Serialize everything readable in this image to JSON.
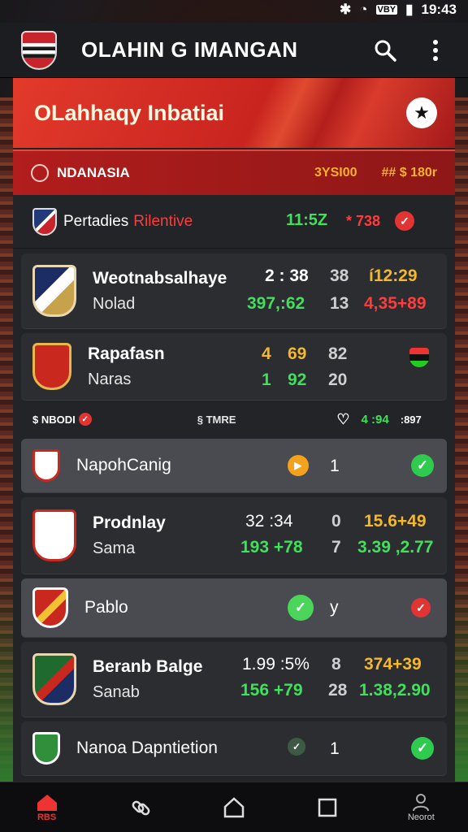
{
  "status": {
    "signal_badge": "VBY",
    "time": "19:43"
  },
  "appbar": {
    "title": "OLAHIN G IMANGAN"
  },
  "hero": {
    "title": "OLahhaqy Inbatiai"
  },
  "league": {
    "name": "NDANASIA",
    "code": "3YSI00",
    "odds": "## $ 180r"
  },
  "section": {
    "name": "Pertadies",
    "highlight": "Rilentive",
    "time": "11:5Z",
    "value": "* 738"
  },
  "matches": [
    {
      "name1": "Weotnabsalhaye",
      "name2": "Nolad",
      "a1": "2 : 38",
      "a2": "397,:62",
      "b1": "38",
      "b2": "13",
      "c1": "í12:29",
      "c2": "4,35+89"
    },
    {
      "name1": "Rapafasn",
      "name2": "Naras",
      "a1": "4",
      "a1b": "69",
      "a2": "1",
      "a2b": "92",
      "b1": "82",
      "b2": "20"
    },
    {
      "name1": "Prodnlay",
      "name2": "Sama",
      "a1": "32 :34",
      "a2": "193 +78",
      "b1": "0",
      "b2": "7",
      "c1": "15.6+49",
      "c2": "3.39 ,2.77"
    },
    {
      "name1": "Beranb Balge",
      "name2": "Sanab",
      "a1": "1.99 :5%",
      "a2": "156 +79",
      "b1": "8",
      "b2": "28",
      "c1": "374+39",
      "c2": "1.38,2.90"
    }
  ],
  "mini": {
    "left": "$ NBODI",
    "mid": "§ TMRE",
    "right1": "4 :94",
    "right2": ":897"
  },
  "simple": [
    {
      "name": "NapohCanig",
      "num": "1"
    },
    {
      "name": "Pablo",
      "num": "y"
    },
    {
      "name": "Nanoa Dapntietion",
      "num": "1"
    }
  ],
  "nav": {
    "home": "RBS",
    "profile": "Neorot"
  },
  "colors": {
    "accent": "#d32a24",
    "green": "#3fe05a",
    "gold": "#f6b82b"
  }
}
